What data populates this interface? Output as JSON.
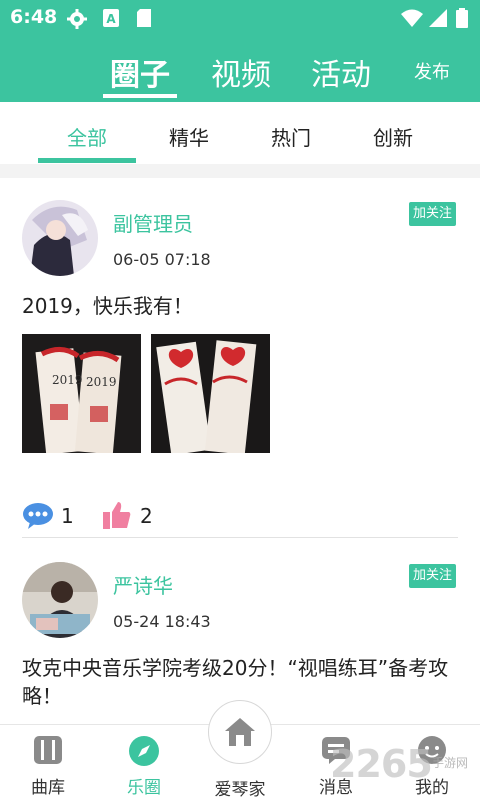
{
  "status_bar": {
    "time": "6:48"
  },
  "header": {
    "tabs": [
      {
        "label": "圈子",
        "active": true
      },
      {
        "label": "视频",
        "active": false
      },
      {
        "label": "活动",
        "active": false
      }
    ],
    "publish_label": "发布"
  },
  "subtabs": [
    {
      "label": "全部",
      "active": true
    },
    {
      "label": "精华",
      "active": false
    },
    {
      "label": "热门",
      "active": false
    },
    {
      "label": "创新",
      "active": false
    }
  ],
  "posts": [
    {
      "username": "副管理员",
      "date": "06-05 07:18",
      "follow_label": "加关注",
      "text": "2019，快乐我有！",
      "comments": "1",
      "likes": "2"
    },
    {
      "username": "严诗华",
      "date": "05-24 18:43",
      "follow_label": "加关注",
      "text": "攻克中央音乐学院考级20分！“视唱练耳”备考攻略！"
    }
  ],
  "bottom_nav": [
    {
      "label": "曲库",
      "icon": "library-icon"
    },
    {
      "label": "乐圈",
      "icon": "compass-icon",
      "active": true
    },
    {
      "label": "爱琴家",
      "icon": "home-icon"
    },
    {
      "label": "消息",
      "icon": "message-icon"
    },
    {
      "label": "我的",
      "icon": "profile-icon"
    }
  ],
  "watermark": {
    "main": "2265",
    "sub": "手游网"
  },
  "colors": {
    "accent": "#3cc49f",
    "like": "#f07fa0",
    "comment": "#4a90e2"
  }
}
